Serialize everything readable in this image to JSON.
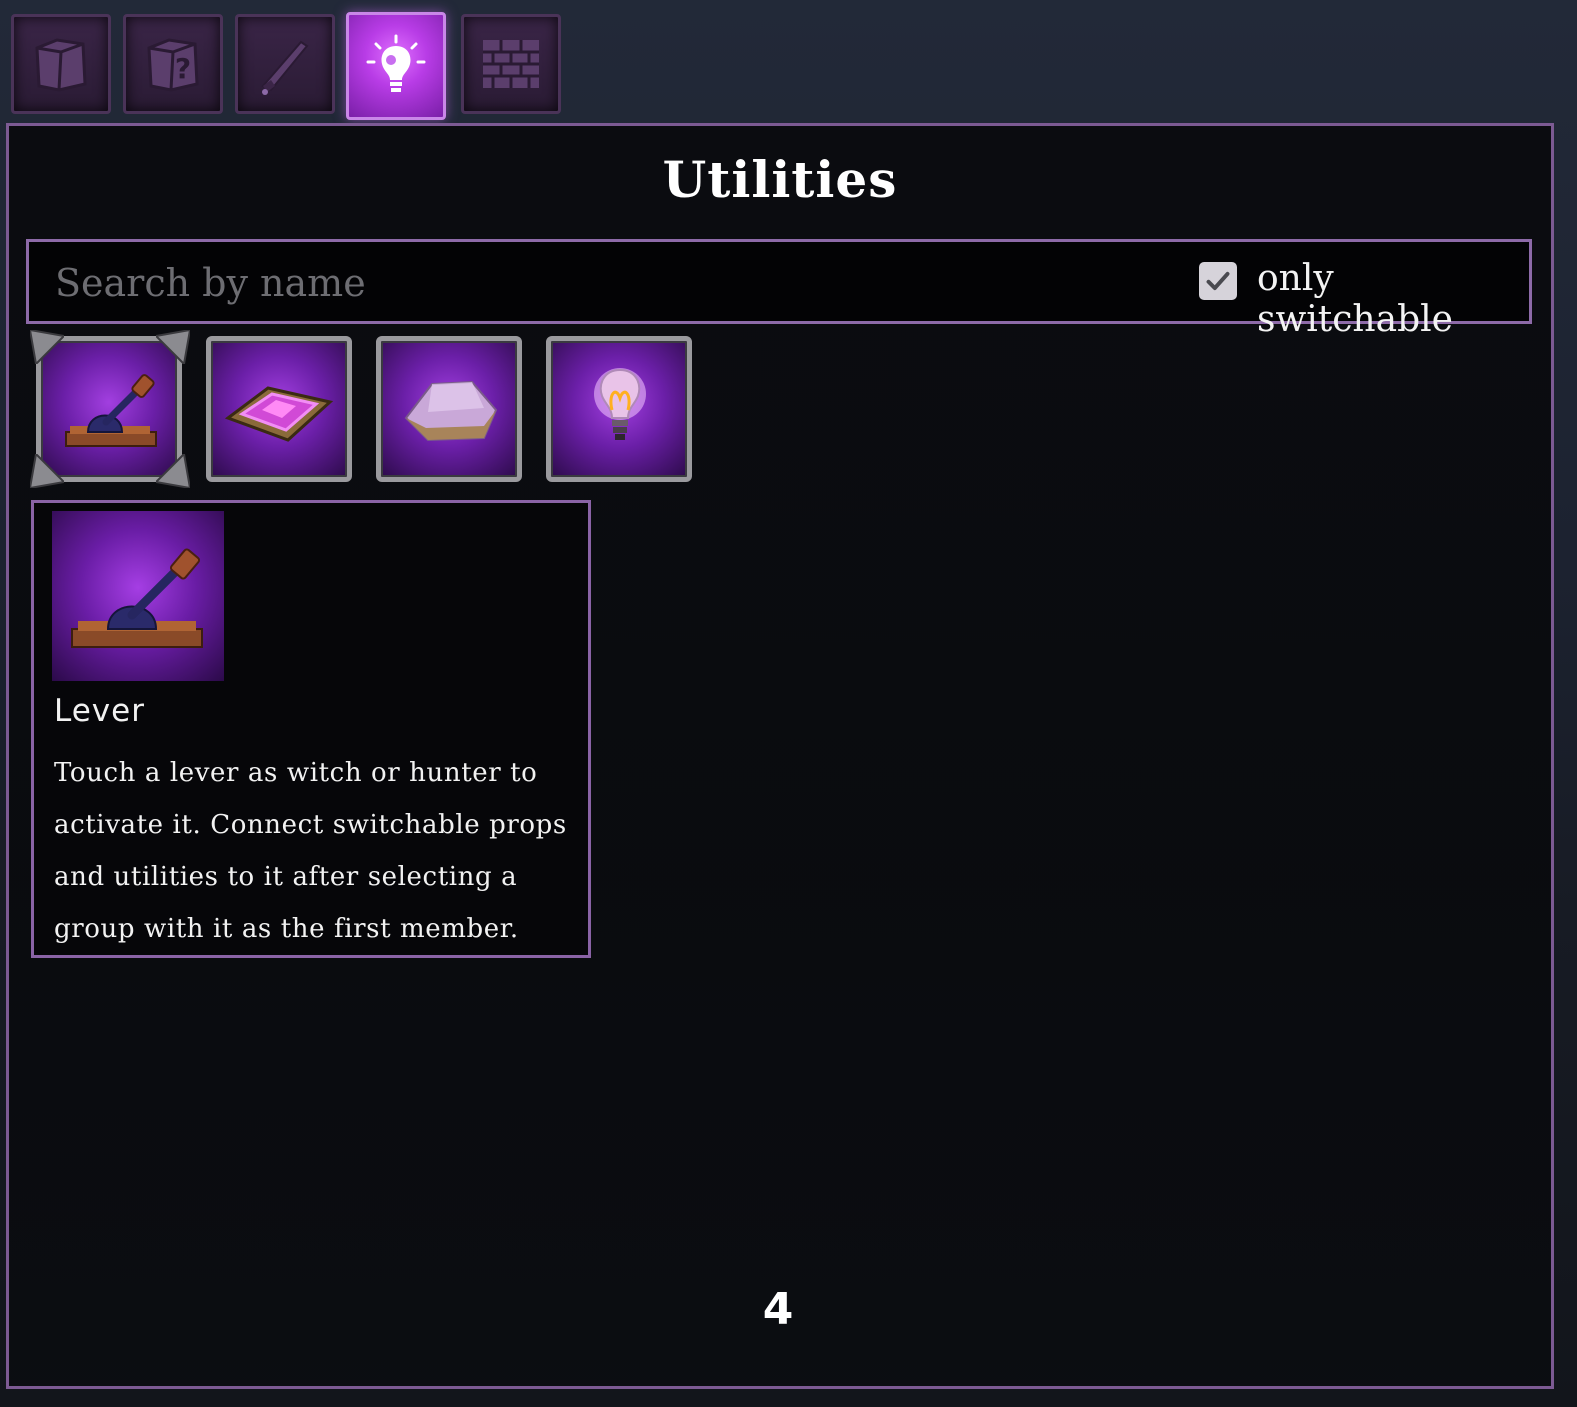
{
  "tabs": [
    {
      "name": "box-icon",
      "active": false
    },
    {
      "name": "mystery-box-icon",
      "active": false
    },
    {
      "name": "wand-icon",
      "active": false
    },
    {
      "name": "lightbulb-icon",
      "active": true
    },
    {
      "name": "brick-wall-icon",
      "active": false
    }
  ],
  "panel": {
    "title": "Utilities",
    "search": {
      "placeholder": "Search by name",
      "value": ""
    },
    "filter": {
      "label": "only switchable",
      "checked": true
    }
  },
  "items": [
    {
      "name": "lever-icon",
      "selected": true
    },
    {
      "name": "pressure-plate-icon",
      "selected": false
    },
    {
      "name": "crystal-plate-icon",
      "selected": false
    },
    {
      "name": "lightbulb-icon",
      "selected": false
    }
  ],
  "tooltip": {
    "title": "Lever",
    "description": "Touch a lever as witch or hunter to activate it. Connect switchable props and utilities to it after selecting a group with it as the first member."
  },
  "page_count": "4",
  "colors": {
    "accent": "#8d6aa8",
    "active_tab": "#b83ce6",
    "slot_glow": "#a23fe0"
  }
}
